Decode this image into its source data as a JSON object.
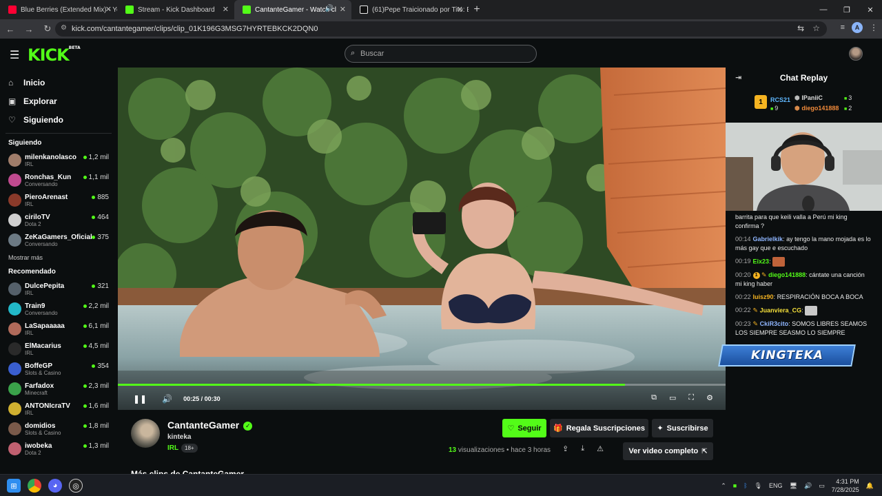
{
  "browser": {
    "tabs": [
      {
        "title": "Blue Berries (Extended Mix) - Yo",
        "favicon_color": "#ff0033",
        "active": false
      },
      {
        "title": "Stream - Kick Dashboard",
        "favicon_color": "#53fc18",
        "active": false
      },
      {
        "title": "CantanteGamer - Watch cl",
        "favicon_color": "#53fc18",
        "active": true
      },
      {
        "title": "(61)Pepe Traicionado por Tito: E",
        "favicon_color": "#ffffff",
        "active": false
      }
    ],
    "url": "kick.com/cantantegamer/clips/clip_01K196G3MSG7HYRTEBKCK2DQN0",
    "profile_initial": "A"
  },
  "kick": {
    "logo": "KICK",
    "logo_beta": "BETA",
    "search_placeholder": "Buscar",
    "accent": "#53fc18"
  },
  "sidebar": {
    "nav": [
      {
        "label": "Inicio",
        "icon": "home-icon"
      },
      {
        "label": "Explorar",
        "icon": "compass-icon"
      },
      {
        "label": "Siguiendo",
        "icon": "heart-icon"
      }
    ],
    "following_header": "Siguiendo",
    "following": [
      {
        "name": "milenkanolasco",
        "category": "IRL",
        "viewers": "1,2 mil",
        "color": "#a07d6a"
      },
      {
        "name": "Ronchas_Kun",
        "category": "Conversando",
        "viewers": "1,1 mil",
        "color": "#c04a8f"
      },
      {
        "name": "PieroArenast",
        "category": "IRL",
        "viewers": "885",
        "color": "#8a3a2a"
      },
      {
        "name": "ciriloTV",
        "category": "Dota 2",
        "viewers": "464",
        "color": "#cfcfcf"
      },
      {
        "name": "ZeKaGamers_Oficial",
        "category": "Conversando",
        "viewers": "375",
        "color": "#6c7a84"
      }
    ],
    "show_more": "Mostrar más",
    "recommended_header": "Recomendado",
    "recommended": [
      {
        "name": "DulcePepita",
        "category": "IRL",
        "viewers": "321",
        "color": "#55606a"
      },
      {
        "name": "Train9",
        "category": "Conversando",
        "viewers": "2,2 mil",
        "color": "#22b8c8"
      },
      {
        "name": "LaSapaaaaa",
        "category": "IRL",
        "viewers": "6,1 mil",
        "color": "#b06a5a"
      },
      {
        "name": "ElMacarius",
        "category": "IRL",
        "viewers": "4,5 mil",
        "color": "#2a2a2a"
      },
      {
        "name": "BoffeGP",
        "category": "Slots & Casino",
        "viewers": "354",
        "color": "#3a5fd0"
      },
      {
        "name": "Farfadox",
        "category": "Minecraft",
        "viewers": "2,3 mil",
        "color": "#3aa24a"
      },
      {
        "name": "ANTONIcraTV",
        "category": "IRL",
        "viewers": "1,6 mil",
        "color": "#d0b030"
      },
      {
        "name": "domidios",
        "category": "Slots & Casino",
        "viewers": "1,8 mil",
        "color": "#7a5a4a"
      },
      {
        "name": "iwobeka",
        "category": "Dota 2",
        "viewers": "1,3 mil",
        "color": "#c06070"
      }
    ]
  },
  "player": {
    "time_current": "0:25",
    "time_total": "00:30",
    "time_display": "00:25 / 00:30",
    "progress_fraction": 0.835
  },
  "clip": {
    "channel": "CantanteGamer",
    "username": "kinteka",
    "category": "IRL",
    "age": "18+",
    "follow": "Seguir",
    "gift": "Regala Suscripciones",
    "subscribe": "Suscribirse",
    "views_count": "13",
    "views_label": "visualizaciones",
    "posted": "hace 3 horas",
    "full_video": "Ver video completo",
    "more_clips": "Más clips de CantanteGamer"
  },
  "chat": {
    "title": "Chat Replay",
    "leaders": [
      {
        "rank": "1",
        "name": "RCS21",
        "count": "9",
        "color": "#5fb8ff"
      },
      {
        "name": "IPaniiC",
        "count": "3",
        "color": "#dddddd"
      },
      {
        "name": "diego141888",
        "count": "2",
        "color": "#f08a3a"
      }
    ],
    "messages": [
      {
        "ts": "",
        "user": "",
        "text": "barrita para que keili valla a Perú mi king confirma ?",
        "user_color": "#ffffff"
      },
      {
        "ts": "00:14",
        "user": "Gabrielkik",
        "text": "ay tengo la mano mojada es lo más gay que e escuchado",
        "user_color": "#8fb6ff"
      },
      {
        "ts": "00:19",
        "user": "Eix23",
        "text": "",
        "user_color": "#53fc18"
      },
      {
        "ts": "00:20",
        "user": "diego141888",
        "text": "cántate una canción mi king haber",
        "user_color": "#53fc18"
      },
      {
        "ts": "00:22",
        "user": "luisz90",
        "text": "RESPIRACIÓN BOCA A BOCA",
        "user_color": "#f5b321"
      },
      {
        "ts": "00:22",
        "user": "Juanviera_CG",
        "text": "",
        "user_color": "#f5e03a"
      },
      {
        "ts": "00:23",
        "user": "CkiR3cito",
        "text": "SOMOS LIBRES SEAMOS LOS SIEMPRE SEASMO LO SIEMPRE",
        "user_color": "#8fb6ff"
      }
    ],
    "overlay_banner": "KINGTEKA"
  },
  "taskbar": {
    "lang": "ENG",
    "time": "4:31 PM",
    "date": "7/28/2025"
  }
}
